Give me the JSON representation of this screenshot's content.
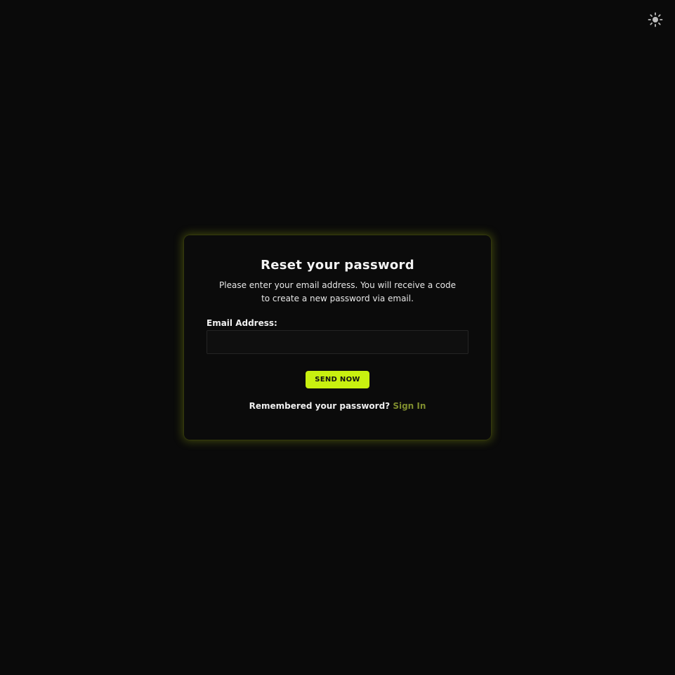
{
  "header": {
    "theme_toggle_icon": "sun-icon"
  },
  "card": {
    "title": "Reset your password",
    "subtitle": "Please enter your email address. You will receive a code to create a new password via email.",
    "email_label": "Email Address:",
    "email_value": "",
    "email_placeholder": "",
    "send_button_label": "SEND NOW",
    "footer_prompt": "Remembered your password?",
    "signin_link_label": "Sign In"
  },
  "colors": {
    "background": "#0a0a0a",
    "card_background": "#0b0b0b",
    "accent": "#c8f010",
    "link": "#7f8d2e",
    "glow": "#96aa14"
  }
}
